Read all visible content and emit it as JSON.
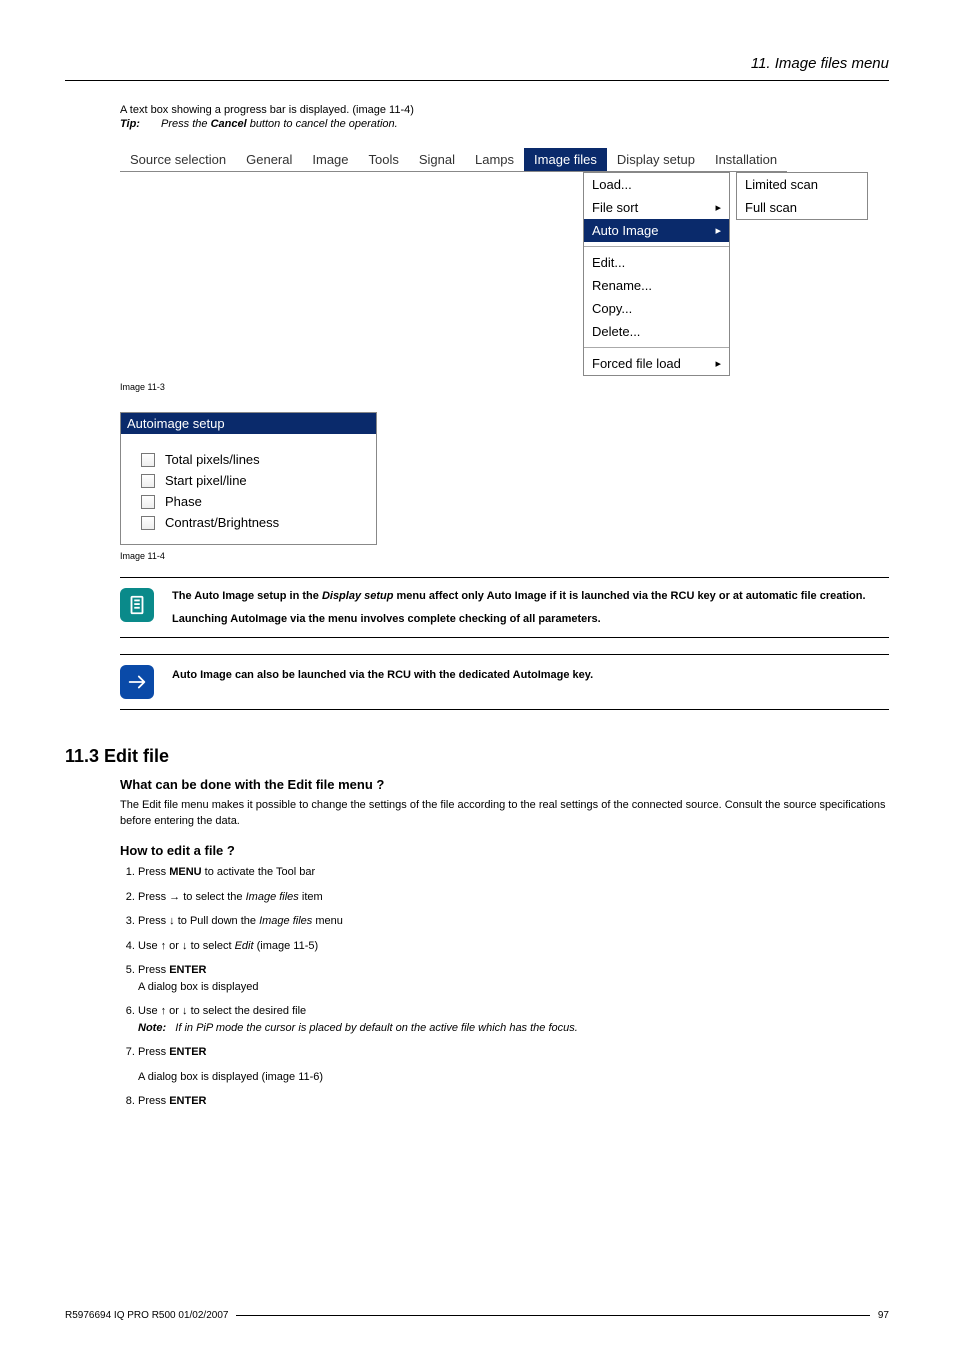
{
  "header": {
    "breadcrumb": "11.  Image files menu"
  },
  "intro": {
    "line1": "A text box showing a progress bar is displayed.  (image 11-4)",
    "tip_label": "Tip:",
    "tip_before": "Press the ",
    "tip_bold": "Cancel",
    "tip_after": " button to cancel the operation."
  },
  "menubar": {
    "items": [
      "Source selection",
      "General",
      "Image",
      "Tools",
      "Signal",
      "Lamps",
      "Image files",
      "Display setup",
      "Installation"
    ],
    "selected": "Image files"
  },
  "dropdown": {
    "items": [
      {
        "label": "Load..."
      },
      {
        "label": "File sort",
        "arrow": true
      },
      {
        "label": "Auto Image",
        "arrow": true,
        "selected": true
      },
      {
        "label": "Edit...",
        "gap_before": true
      },
      {
        "label": "Rename..."
      },
      {
        "label": "Copy..."
      },
      {
        "label": "Delete..."
      },
      {
        "label": "Forced file load",
        "arrow": true,
        "gap_before": true
      }
    ]
  },
  "submenu": {
    "items": [
      "Limited scan",
      "Full scan"
    ]
  },
  "caption1": "Image 11-3",
  "autoimage": {
    "title": "Autoimage setup",
    "rows": [
      "Total pixels/lines",
      "Start pixel/line",
      "Phase",
      "Contrast/Brightness"
    ]
  },
  "caption2": "Image 11-4",
  "note1": {
    "p1_a": "The Auto Image setup in the ",
    "p1_i": "Display setup",
    "p1_b": " menu affect only Auto Image if it is launched via the RCU key or at automatic file creation.",
    "p2": "Launching AutoImage via the menu involves complete checking of all parameters."
  },
  "note2": {
    "text": "Auto Image can also be launched via the RCU with the dedicated AutoImage key."
  },
  "section": {
    "heading": "11.3  Edit file",
    "sub1": "What can be done with the Edit file menu ?",
    "body1": "The Edit file menu makes it possible to change the settings of the file according to the real settings of the connected source.  Consult the source specifications before entering the data.",
    "sub2": "How to edit a file ?",
    "steps": {
      "s1_a": "Press ",
      "s1_b": "MENU",
      "s1_c": " to activate the Tool bar",
      "s2_a": "Press → to select the ",
      "s2_i": "Image files",
      "s2_c": " item",
      "s3_a": "Press ↓ to Pull down the ",
      "s3_i": "Image files",
      "s3_c": " menu",
      "s4_a": "Use ↑ or ↓ to select ",
      "s4_i": "Edit",
      "s4_c": " (image 11-5)",
      "s5_a": "Press ",
      "s5_b": "ENTER",
      "s5_line2": "A dialog box is displayed",
      "s6_a": "Use ↑ or ↓ to select the desired file",
      "s6_note_label": "Note:",
      "s6_note": "If in PiP mode the cursor is placed by default on the active file which has the focus.",
      "s7_a": "Press ",
      "s7_b": "ENTER",
      "s7_line2": "A dialog box is displayed (image 11-6)",
      "s8_a": "Press ",
      "s8_b": "ENTER"
    }
  },
  "footer": {
    "left": "R5976694  IQ PRO R500  01/02/2007",
    "right": "97"
  }
}
